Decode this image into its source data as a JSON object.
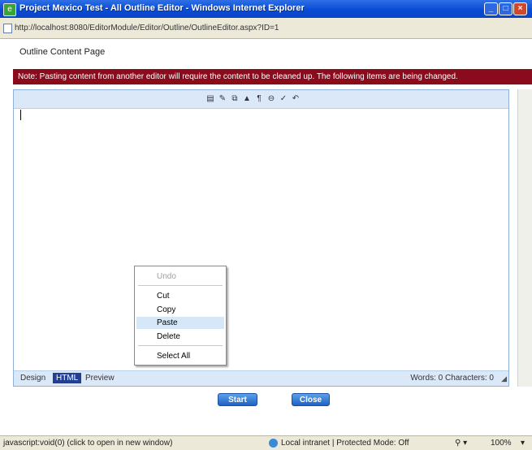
{
  "window": {
    "title": "Project Mexico Test - All Outline Editor - Windows Internet Explorer",
    "minimize": "_",
    "maximize": "□",
    "close": "×",
    "url": "http://localhost:8080/EditorModule/Editor/Outline/OutlineEditor.aspx?ID=1"
  },
  "page": {
    "heading": "Outline Content Page",
    "notice": "Note: Pasting content from another editor will require the content to be cleaned up. The following items are being changed."
  },
  "editor": {
    "toolbar": [
      {
        "icon": "save-icon",
        "glyph": "▤"
      },
      {
        "icon": "edit-icon",
        "glyph": "✎"
      },
      {
        "icon": "copy-icon",
        "glyph": "⧉"
      },
      {
        "icon": "highlight-icon",
        "glyph": "▲"
      },
      {
        "icon": "paste-text-icon",
        "glyph": "¶"
      },
      {
        "icon": "link-icon",
        "glyph": "⊖"
      },
      {
        "icon": "spell-icon",
        "glyph": "✓"
      },
      {
        "icon": "undo-icon",
        "glyph": "↶"
      }
    ],
    "mode_tabs": [
      "Design",
      "HTML",
      "Preview"
    ],
    "active_mode": "HTML",
    "word_count": "Words: 0 Characters: 0",
    "resize_grip": "◢"
  },
  "context_menu": {
    "items": [
      {
        "label": "Undo",
        "disabled": true
      },
      {
        "label": "Cut",
        "disabled": false
      },
      {
        "label": "Copy",
        "disabled": false
      },
      {
        "label": "Paste",
        "disabled": false,
        "hover": true
      },
      {
        "label": "Delete",
        "disabled": false
      },
      {
        "label": "Select All",
        "disabled": false
      }
    ]
  },
  "actions": {
    "start": "Start",
    "close": "Close"
  },
  "status": {
    "url": "javascript:void(0) (click to open in new window)",
    "zone": "Local intranet | Protected Mode: Off",
    "controls": "⚲ ▾",
    "zoom": "100%",
    "zoom_arrow": "▾"
  },
  "colors": {
    "notice_bg": "#8a0b1b",
    "titlebar": "#0a4bd6",
    "toolbar_bg": "#dbe8f8"
  }
}
